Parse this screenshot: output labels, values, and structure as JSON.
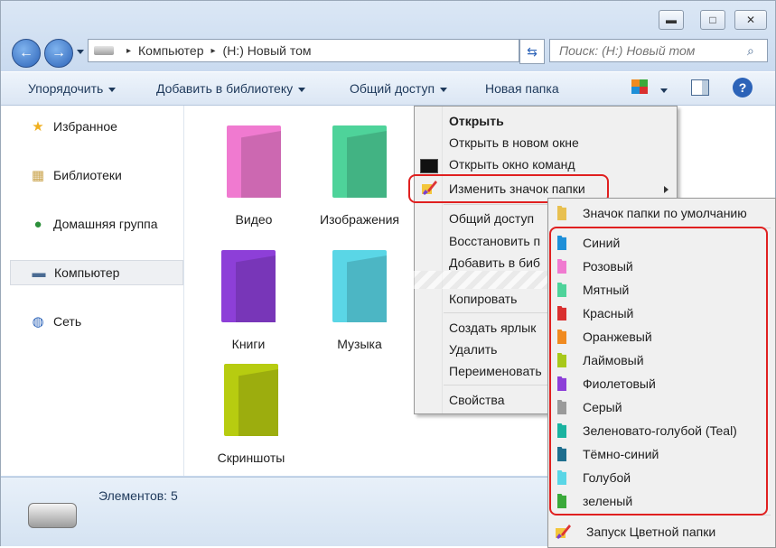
{
  "window": {
    "minimize": "▬",
    "maximize": "□",
    "close": "✕"
  },
  "nav": {
    "back": "←",
    "forward": "→",
    "address": {
      "segment1": "Компьютер",
      "segment2": "(H:) Новый том",
      "sep": "▸"
    },
    "refresh": "⇆",
    "search_placeholder": "Поиск: (H:) Новый том",
    "search_icon": "⌕"
  },
  "toolbar": {
    "organize": "Упорядочить",
    "add_library": "Добавить в библиотеку",
    "share": "Общий доступ",
    "new_folder": "Новая папка",
    "help": "?"
  },
  "sidebar": {
    "items": [
      {
        "label": "Избранное",
        "icon": "star-icon",
        "glyph": "★"
      },
      {
        "label": "Библиотеки",
        "icon": "library-icon",
        "glyph": "▦"
      },
      {
        "label": "Домашняя группа",
        "icon": "homegroup-icon",
        "glyph": "●"
      },
      {
        "label": "Компьютер",
        "icon": "computer-icon",
        "glyph": "▬"
      },
      {
        "label": "Сеть",
        "icon": "network-icon",
        "glyph": "◍"
      }
    ]
  },
  "folders": [
    {
      "label": "Видео",
      "color": "#f07ad0"
    },
    {
      "label": "Изображения",
      "color": "#4ed39a"
    },
    {
      "label": "Книги",
      "color": "#8d3fd8"
    },
    {
      "label": "Музыка",
      "color": "#5ad6e6"
    },
    {
      "label": "Скриншоты",
      "color": "#b7cc10"
    }
  ],
  "context_menu": {
    "open": "Открыть",
    "open_new_window": "Открыть в новом окне",
    "open_cmd": "Открыть окно команд",
    "change_icon": "Изменить значок папки",
    "share": "Общий доступ",
    "restore": "Восстановить п",
    "add_to": "Добавить в биб",
    "copy": "Копировать",
    "create_shortcut": "Создать ярлык",
    "delete": "Удалить",
    "rename": "Переименовать",
    "properties": "Свойства"
  },
  "submenu": {
    "default": {
      "label": "Значок папки по умолчанию",
      "color": "#e8c050"
    },
    "colors": [
      {
        "label": "Синий",
        "color": "#1e8fd8"
      },
      {
        "label": "Розовый",
        "color": "#f07ad0"
      },
      {
        "label": "Мятный",
        "color": "#4ed39a"
      },
      {
        "label": "Красный",
        "color": "#d93030"
      },
      {
        "label": "Оранжевый",
        "color": "#f08a20"
      },
      {
        "label": "Лаймовый",
        "color": "#a8c81a"
      },
      {
        "label": "Фиолетовый",
        "color": "#8d3fd8"
      },
      {
        "label": "Серый",
        "color": "#9a9a9a"
      },
      {
        "label": "Зеленовато-голубой (Teal)",
        "color": "#1ab3a0"
      },
      {
        "label": "Тёмно-синий",
        "color": "#1e6e8e"
      },
      {
        "label": "Голубой",
        "color": "#5ad6e6"
      },
      {
        "label": "зеленый",
        "color": "#3aa93a"
      }
    ],
    "launch": "Запуск Цветной папки"
  },
  "status": {
    "items_count": "Элементов: 5"
  }
}
